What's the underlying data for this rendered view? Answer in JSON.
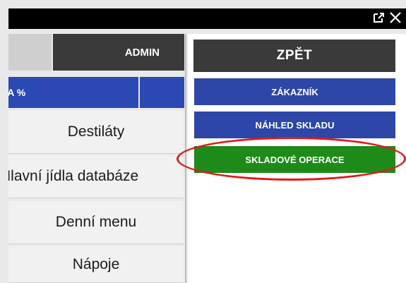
{
  "window": {
    "icons": [
      "external-link-icon",
      "close-icon"
    ]
  },
  "left": {
    "admin_label": "ADMIN",
    "blue_strip_label": "VA %",
    "categories": [
      "Destiláty",
      "Hlavní jídla databáze",
      "Denní menu",
      "Nápoje"
    ]
  },
  "right": {
    "back_label": "ZPĚT",
    "customer_label": "ZÁKAZNÍK",
    "stock_preview_label": "NÁHLED SKLADU",
    "stock_operations_label": "SKLADOVÉ OPERACE"
  },
  "colors": {
    "titlebar": "#000000",
    "dark_button": "#3a3a3a",
    "blue_button": "#2d46a8",
    "green_button": "#1e8a19",
    "highlight": "#e01b1b"
  }
}
